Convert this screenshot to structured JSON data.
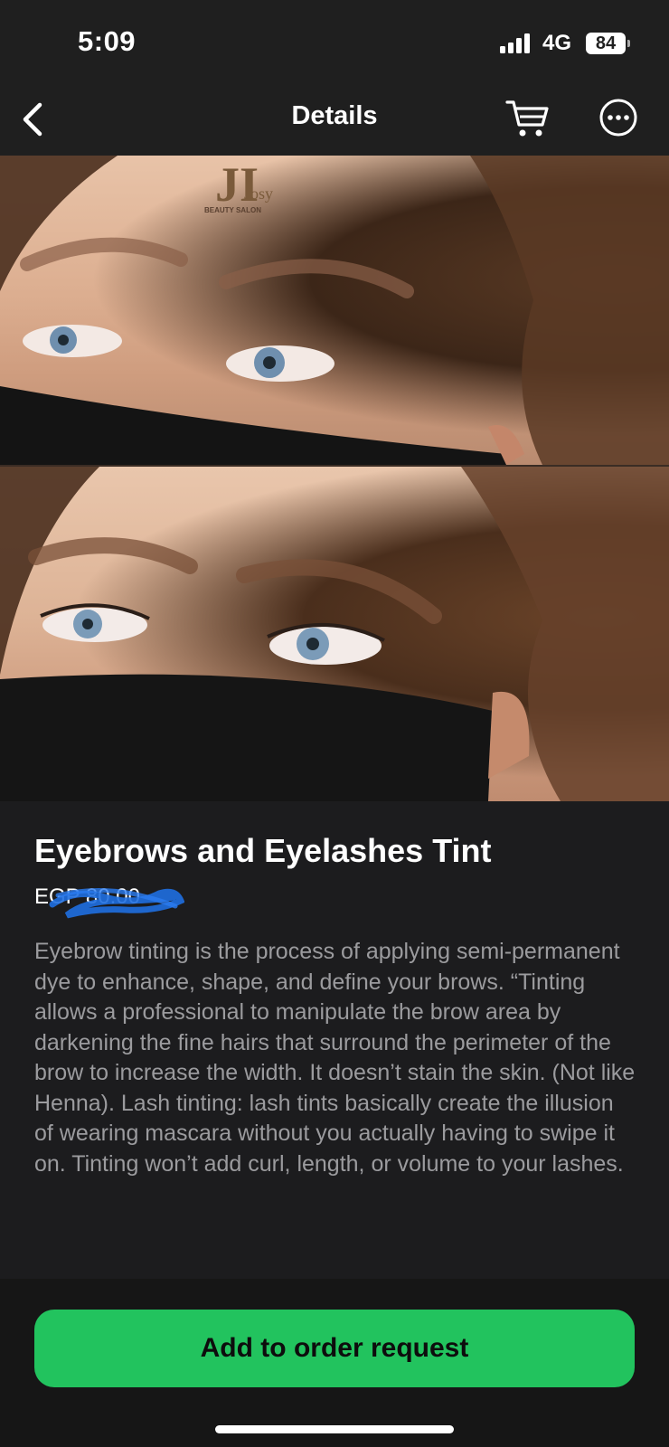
{
  "status_bar": {
    "time": "5:09",
    "network": "4G",
    "battery": "84"
  },
  "nav": {
    "title": "Details",
    "icons": [
      "chevron-left-icon",
      "cart-icon",
      "more-icon"
    ]
  },
  "images": {
    "logo_text": "Josy",
    "logo_subtext": "BEAUTY SALON"
  },
  "product": {
    "title": "Eyebrows and Eyelashes Tint",
    "price": "EGP 80.00",
    "description": "Eyebrow tinting is the process of applying semi-permanent dye to enhance, shape, and define your brows. “Tinting allows a professional to manipulate the brow area by darkening the fine hairs that surround the perimeter of the brow to increase the width. It doesn’t stain the skin. (Not like Henna). Lash tinting: lash tints basically create the illusion of wearing mascara without you actually having to swipe it on. Tinting won’t add curl, length, or volume to your lashes."
  },
  "actions": {
    "add_to_order_label": "Add to order request"
  },
  "colors": {
    "background": "#1c1c1e",
    "accent_green": "#22c35e",
    "description_text": "#9b9b9e",
    "scribble_blue": "#1f6fe0"
  }
}
